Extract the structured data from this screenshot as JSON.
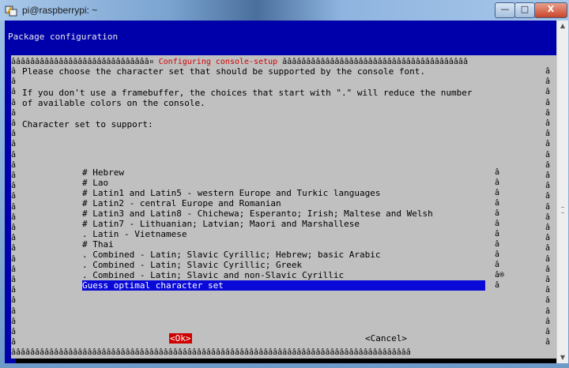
{
  "window": {
    "title": "pi@raspberrypi: ~",
    "min_glyph": "—",
    "max_glyph": "□",
    "close_glyph": "X"
  },
  "terminal": {
    "package_title": "Package configuration",
    "frame_top_left": "âââââââââââââââââââââââââââââ¤ ",
    "dialog_title": "Configuring console-setup",
    "frame_top_right": " âââââââââââââââââââââââââââââââââââââââ",
    "frame_bottom": "ââââââââââââââââââââââââââââââââââââââââââââââââââââââââââââââââââââââââââââââââââââ",
    "frame_glyph": "â",
    "message_1": "Please choose the character set that should be supported by the console font.",
    "message_2a": "If you don't use a framebuffer, the choices that start with \".\" will reduce the number",
    "message_2b": "of available colors on the console.",
    "prompt": "Character set to support:",
    "options": [
      "# Hebrew",
      "# Lao",
      "# Latin1 and Latin5 - western Europe and Turkic languages",
      "# Latin2 - central Europe and Romanian",
      "# Latin3 and Latin8 - Chichewa; Esperanto; Irish; Maltese and Welsh",
      "# Latin7 - Lithuanian; Latvian; Maori and Marshallese",
      ". Latin - Vietnamese",
      "# Thai",
      ". Combined - Latin; Slavic Cyrillic; Hebrew; basic Arabic",
      ". Combined - Latin; Slavic Cyrillic; Greek",
      ". Combined - Latin; Slavic and non-Slavic Cyrillic",
      "Guess optimal character set"
    ],
    "selected_index": 11,
    "list_marker": "â",
    "list_marker_thumb": "â®",
    "ok_label": "<Ok>",
    "cancel_label": "<Cancel>"
  },
  "colors": {
    "terminal_bg": "#0000aa",
    "dialog_bg": "#c0c0c0",
    "accent_red": "#d00000",
    "selection": "#0a0ad8"
  }
}
